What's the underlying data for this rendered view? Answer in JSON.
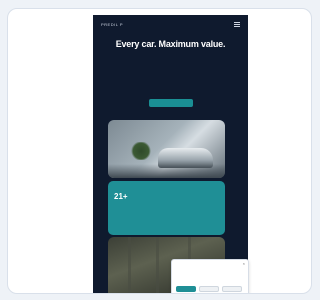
{
  "site": {
    "logo": "PREDIL P",
    "hero_title": "Every car. Maximum value.",
    "hero_subtitle": "",
    "cta_label": ""
  },
  "info_card": {
    "title": "",
    "text": "",
    "stat": "21+",
    "caption": ""
  },
  "photo2": {
    "label": ""
  },
  "cookie_banner": {
    "title": "",
    "text": "",
    "accept_label": "",
    "deny_label": "",
    "prefs_label": "",
    "links": ""
  }
}
